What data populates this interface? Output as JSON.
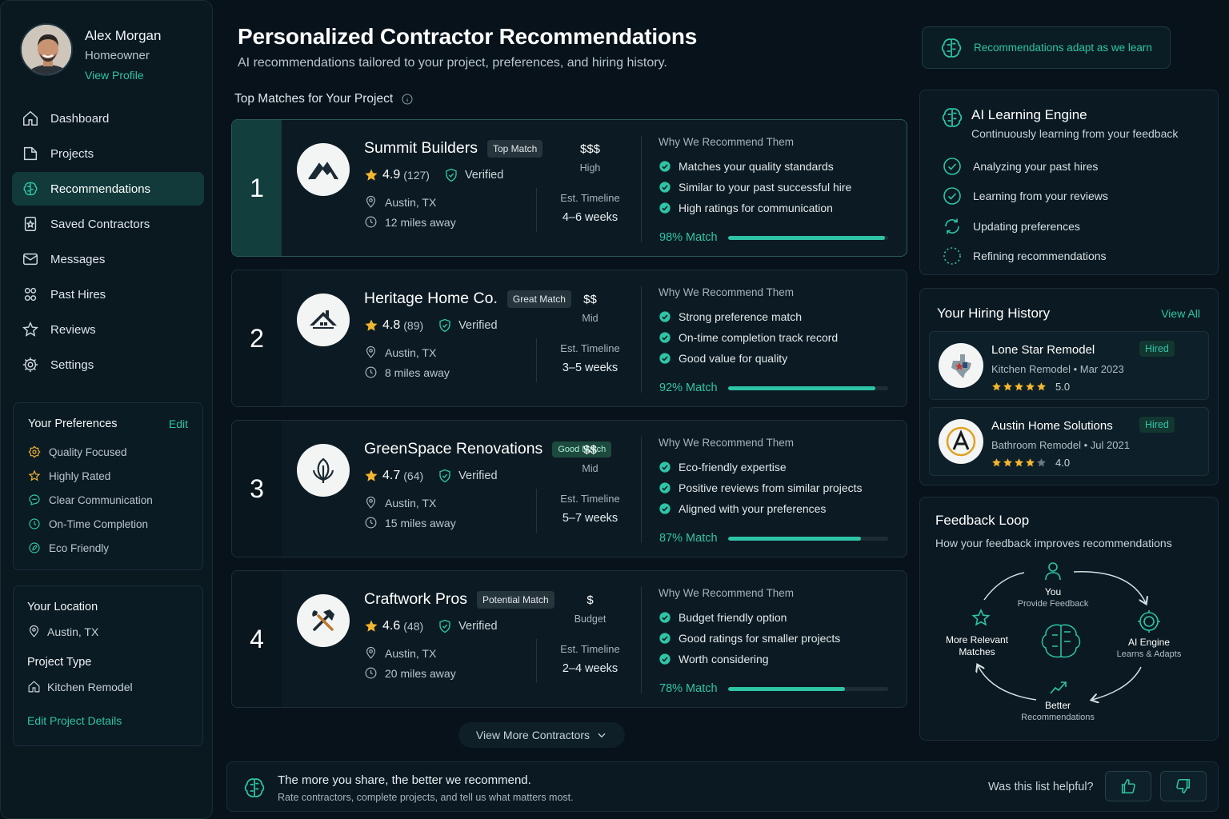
{
  "user": {
    "name": "Alex Morgan",
    "role": "Homeowner",
    "profile_link": "View Profile"
  },
  "nav": {
    "items": [
      {
        "label": "Dashboard",
        "icon": "home-icon"
      },
      {
        "label": "Projects",
        "icon": "folder-icon"
      },
      {
        "label": "Recommendations",
        "icon": "brain-icon",
        "active": true
      },
      {
        "label": "Saved Contractors",
        "icon": "bookmark-icon"
      },
      {
        "label": "Messages",
        "icon": "mail-icon"
      },
      {
        "label": "Past Hires",
        "icon": "users-icon"
      },
      {
        "label": "Reviews",
        "icon": "star-icon"
      },
      {
        "label": "Settings",
        "icon": "gear-icon"
      }
    ]
  },
  "preferences": {
    "title": "Your Preferences",
    "edit": "Edit",
    "items": [
      "Quality Focused",
      "Highly Rated",
      "Clear Communication",
      "On-Time Completion",
      "Eco Friendly"
    ]
  },
  "location": {
    "title": "Your Location",
    "value": "Austin, TX",
    "project_type_label": "Project Type",
    "project_type": "Kitchen Remodel",
    "edit_link": "Edit Project Details"
  },
  "header": {
    "title": "Personalized Contractor Recommendations",
    "subtitle": "AI recommendations tailored to your project, preferences, and hiring history.",
    "section": "Top Matches for Your Project",
    "adapt_badge": "Recommendations adapt as we learn"
  },
  "labels": {
    "why": "Why We Recommend Them",
    "timeline": "Est. Timeline",
    "verified": "Verified"
  },
  "contractors": [
    {
      "rank": "1",
      "name": "Summit Builders",
      "badge": "Top Match",
      "rating": "4.9",
      "reviews": "(127)",
      "location": "Austin, TX",
      "distance": "12 miles away",
      "price": "$$$",
      "price_label": "High",
      "timeline": "4–6 weeks",
      "reasons": [
        "Matches your quality standards",
        "Similar to your past successful hire",
        "High ratings for communication"
      ],
      "match_label": "98% Match",
      "match": 0.98
    },
    {
      "rank": "2",
      "name": "Heritage Home Co.",
      "badge": "Great Match",
      "rating": "4.8",
      "reviews": "(89)",
      "location": "Austin, TX",
      "distance": "8 miles away",
      "price": "$$",
      "price_label": "Mid",
      "timeline": "3–5 weeks",
      "reasons": [
        "Strong preference match",
        "On-time completion track record",
        "Good value for quality"
      ],
      "match_label": "92% Match",
      "match": 0.92
    },
    {
      "rank": "3",
      "name": "GreenSpace Renovations",
      "badge": "Good Match",
      "rating": "4.7",
      "reviews": "(64)",
      "location": "Austin, TX",
      "distance": "15 miles away",
      "price": "$$",
      "price_label": "Mid",
      "timeline": "5–7 weeks",
      "reasons": [
        "Eco-friendly expertise",
        "Positive reviews from similar projects",
        "Aligned with your preferences"
      ],
      "match_label": "87% Match",
      "match": 0.83
    },
    {
      "rank": "4",
      "name": "Craftwork Pros",
      "badge": "Potential Match",
      "rating": "4.6",
      "reviews": "(48)",
      "location": "Austin, TX",
      "distance": "20 miles away",
      "price": "$",
      "price_label": "Budget",
      "timeline": "2–4 weeks",
      "reasons": [
        "Budget friendly option",
        "Good ratings for smaller projects",
        "Worth considering"
      ],
      "match_label": "78% Match",
      "match": 0.73
    }
  ],
  "view_more": "View More Contractors",
  "ai_engine": {
    "title": "AI Learning Engine",
    "subtitle": "Continuously learning from your feedback",
    "steps": [
      "Analyzing your past hires",
      "Learning from your reviews",
      "Updating preferences",
      "Refining recommendations"
    ]
  },
  "history": {
    "title": "Your Hiring History",
    "view_all": "View All",
    "items": [
      {
        "name": "Lone Star Remodel",
        "detail": "Kitchen Remodel • Mar 2023",
        "rating": "5.0",
        "stars": 5,
        "status": "Hired"
      },
      {
        "name": "Austin Home Solutions",
        "detail": "Bathroom Remodel • Jul 2021",
        "rating": "4.0",
        "stars": 4,
        "status": "Hired"
      }
    ]
  },
  "feedback_loop": {
    "title": "Feedback Loop",
    "subtitle": "How your feedback improves recommendations",
    "you": "You",
    "you_sub": "Provide Feedback",
    "ai": "AI Engine",
    "ai_sub": "Learns & Adapts",
    "better": "Better",
    "better_sub": "Recommendations",
    "more_line1": "More Relevant",
    "more_line2": "Matches"
  },
  "footer": {
    "title": "The more you share, the better we recommend.",
    "subtitle": "Rate contractors, complete projects, and tell us what matters most.",
    "question": "Was this list helpful?"
  },
  "colors": {
    "accent": "#2ec4a6",
    "background": "#07121a",
    "star": "#f2b630"
  }
}
